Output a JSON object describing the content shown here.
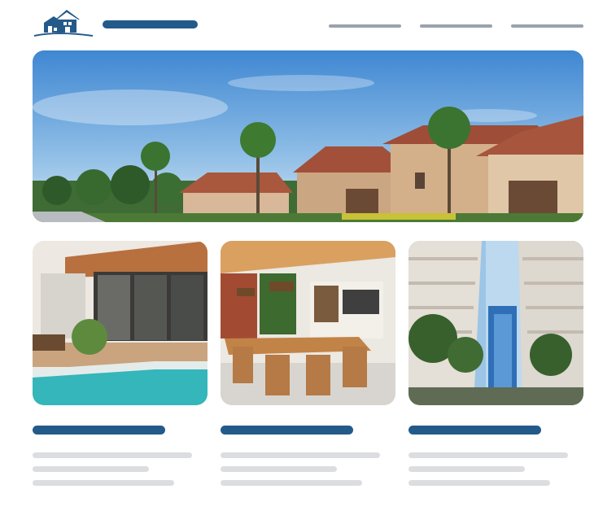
{
  "colors": {
    "primary": "#245a8a",
    "nav_gray": "#9aa3ad",
    "text_placeholder": "#dcdde0",
    "background": "#ffffff"
  },
  "header": {
    "logo_icon": "house-logo-icon",
    "nav_items": [
      "",
      "",
      ""
    ]
  },
  "hero": {
    "image": "luxury-villas-with-palm-trees"
  },
  "cards": [
    {
      "image": "pool-patio-with-pergola"
    },
    {
      "image": "wooden-dining-room-interior"
    },
    {
      "image": "high-rise-apartments-with-palms"
    }
  ]
}
